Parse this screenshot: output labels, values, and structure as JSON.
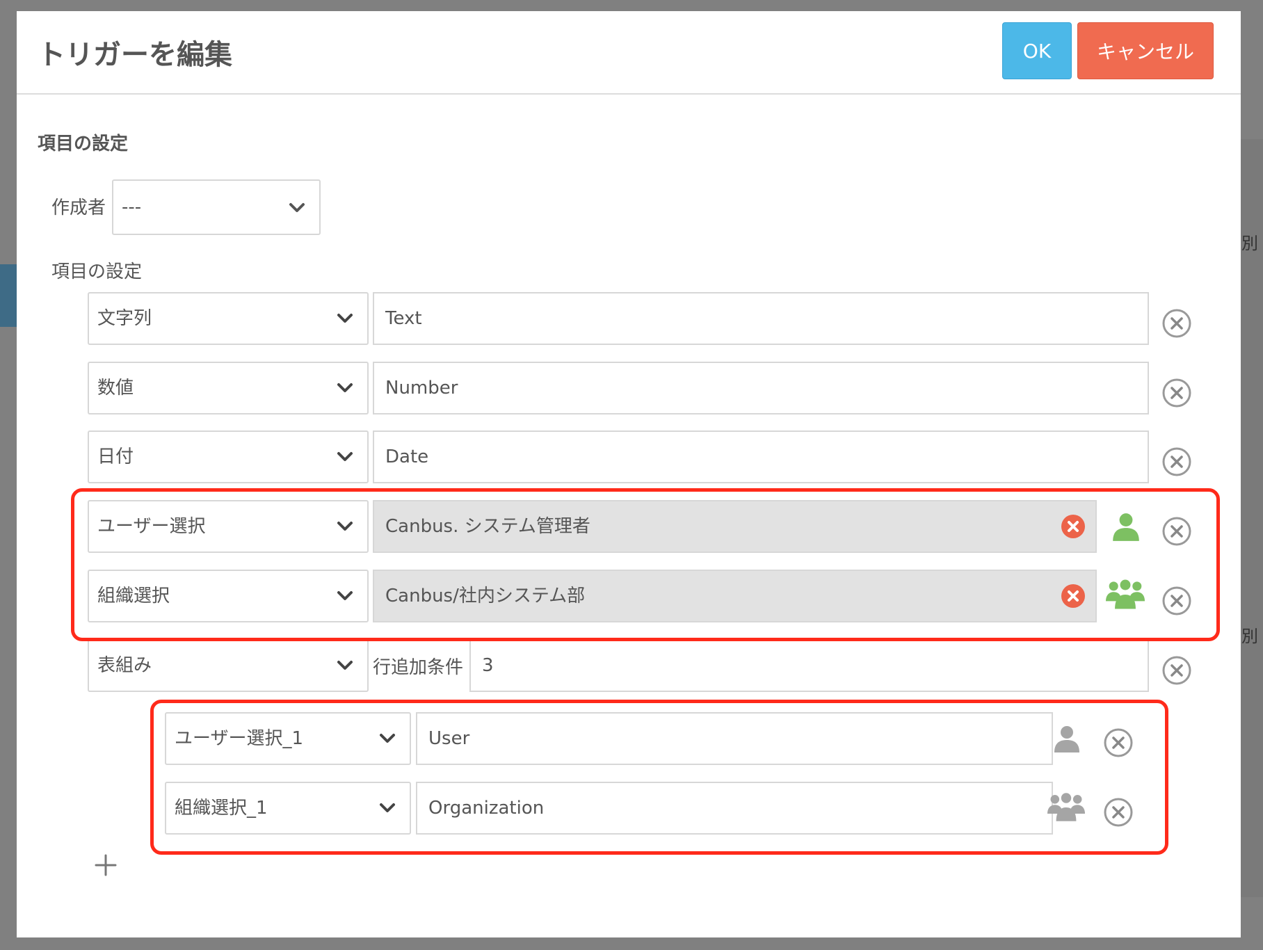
{
  "dialog": {
    "title": "トリガーを編集",
    "ok_label": "OK",
    "cancel_label": "キャンセル"
  },
  "section_title": "項目の設定",
  "creator": {
    "label": "作成者",
    "value": "---"
  },
  "items_label": "項目の設定",
  "rows": [
    {
      "type": "文字列",
      "value": "Text"
    },
    {
      "type": "数値",
      "value": "Number"
    },
    {
      "type": "日付",
      "value": "Date"
    },
    {
      "type": "ユーザー選択",
      "value": "Canbus. システム管理者",
      "icon": "user-icon"
    },
    {
      "type": "組織選択",
      "value": "Canbus/社内システム部",
      "icon": "group-icon"
    },
    {
      "type": "表組み",
      "condition_label": "行追加条件",
      "value": "3"
    }
  ],
  "sub_rows": [
    {
      "type": "ユーザー選択_1",
      "value": "User",
      "icon": "user-icon"
    },
    {
      "type": "組織選択_1",
      "value": "Organization",
      "icon": "group-icon"
    }
  ],
  "background": {
    "edge_text_1": "別",
    "edge_text_2": "別"
  },
  "colors": {
    "ok": "#4cb8e8",
    "cancel": "#f06b50",
    "assigned_icon": "#7dc062",
    "unassigned_icon": "#a5a5a5",
    "clear_badge": "#ec6349",
    "annotation": "#ff2a1a"
  }
}
